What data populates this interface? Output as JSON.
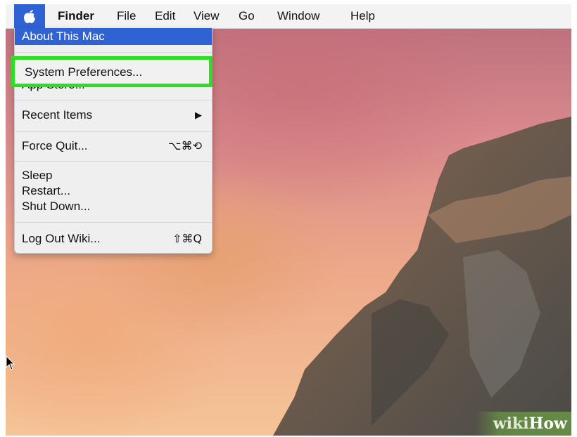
{
  "menubar": {
    "apple_icon": "apple-logo-icon",
    "items": [
      "Finder",
      "File",
      "Edit",
      "View",
      "Go",
      "Window",
      "Help"
    ]
  },
  "apple_menu": {
    "about": "About This Mac",
    "system_preferences": "System Preferences...",
    "app_store": "App Store...",
    "recent_items": "Recent Items",
    "recent_items_arrow": "▶",
    "force_quit": "Force Quit...",
    "force_quit_shortcut": "⌥⌘⟲",
    "sleep": "Sleep",
    "restart": "Restart...",
    "shut_down": "Shut Down...",
    "log_out": "Log Out Wiki...",
    "log_out_shortcut": "⇧⌘Q"
  },
  "highlight_color": "#2be01f",
  "selection_color": "#2f63d3",
  "watermark": {
    "part1": "wiki",
    "part2": "How"
  }
}
